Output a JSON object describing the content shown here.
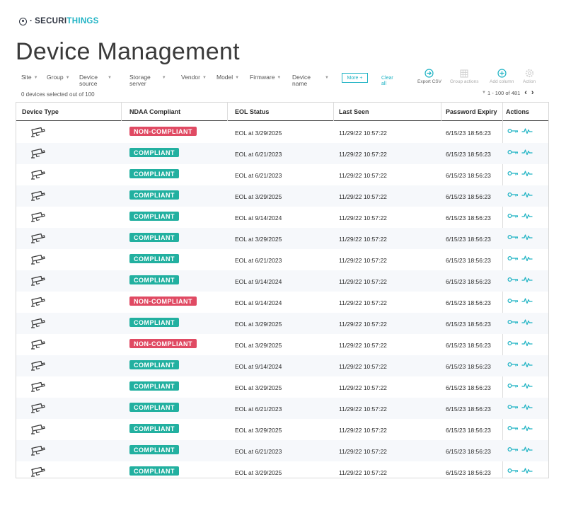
{
  "app": {
    "logo_part1": "SECURI",
    "logo_part2": "THINGS",
    "title": "Device Management"
  },
  "filters": {
    "site": "Site",
    "group": "Group",
    "device_source_1": "Device",
    "device_source_2": "source",
    "storage_server_1": "Storage",
    "storage_server_2": "server",
    "vendor": "Vendor",
    "model": "Model",
    "firmware": "Firmware",
    "device_name_1": "Device",
    "device_name_2": "name",
    "more": "More +",
    "clear_1": "Clear",
    "clear_2": "all"
  },
  "toolbar": {
    "export_csv": "Export CSV",
    "group_actions": "Group actions",
    "add_column": "Add column",
    "action": "Action"
  },
  "selection": "0 devices selected out of 100",
  "pagination": "1 - 100 of 481",
  "columns": {
    "device_type": "Device Type",
    "ndaa": "NDAA Compliant",
    "eol": "EOL Status",
    "last_seen": "Last Seen",
    "password_expiry": "Password Expiry",
    "actions": "Actions"
  },
  "rows": [
    {
      "ndaa": "NON-COMPLIANT",
      "status": "bad",
      "eol": "EOL at 3/29/2025",
      "last_seen": "11/29/22 10:57:22",
      "pwd": "6/15/23 18:56:23"
    },
    {
      "ndaa": "COMPLIANT",
      "status": "ok",
      "eol": "EOL at 6/21/2023",
      "last_seen": "11/29/22 10:57:22",
      "pwd": "6/15/23 18:56:23"
    },
    {
      "ndaa": "COMPLIANT",
      "status": "ok",
      "eol": "EOL at 6/21/2023",
      "last_seen": "11/29/22 10:57:22",
      "pwd": "6/15/23 18:56:23"
    },
    {
      "ndaa": "COMPLIANT",
      "status": "ok",
      "eol": "EOL at 3/29/2025",
      "last_seen": "11/29/22 10:57:22",
      "pwd": "6/15/23 18:56:23"
    },
    {
      "ndaa": "COMPLIANT",
      "status": "ok",
      "eol": "EOL at 9/14/2024",
      "last_seen": "11/29/22 10:57:22",
      "pwd": "6/15/23 18:56:23"
    },
    {
      "ndaa": "COMPLIANT",
      "status": "ok",
      "eol": "EOL at 3/29/2025",
      "last_seen": "11/29/22 10:57:22",
      "pwd": "6/15/23 18:56:23"
    },
    {
      "ndaa": "COMPLIANT",
      "status": "ok",
      "eol": "EOL at 6/21/2023",
      "last_seen": "11/29/22 10:57:22",
      "pwd": "6/15/23 18:56:23"
    },
    {
      "ndaa": "COMPLIANT",
      "status": "ok",
      "eol": "EOL at 9/14/2024",
      "last_seen": "11/29/22 10:57:22",
      "pwd": "6/15/23 18:56:23"
    },
    {
      "ndaa": "NON-COMPLIANT",
      "status": "bad",
      "eol": "EOL at 9/14/2024",
      "last_seen": "11/29/22 10:57:22",
      "pwd": "6/15/23 18:56:23"
    },
    {
      "ndaa": "COMPLIANT",
      "status": "ok",
      "eol": "EOL at 3/29/2025",
      "last_seen": "11/29/22 10:57:22",
      "pwd": "6/15/23 18:56:23"
    },
    {
      "ndaa": "NON-COMPLIANT",
      "status": "bad",
      "eol": "EOL at 3/29/2025",
      "last_seen": "11/29/22 10:57:22",
      "pwd": "6/15/23 18:56:23"
    },
    {
      "ndaa": "COMPLIANT",
      "status": "ok",
      "eol": "EOL at 9/14/2024",
      "last_seen": "11/29/22 10:57:22",
      "pwd": "6/15/23 18:56:23"
    },
    {
      "ndaa": "COMPLIANT",
      "status": "ok",
      "eol": "EOL at 3/29/2025",
      "last_seen": "11/29/22 10:57:22",
      "pwd": "6/15/23 18:56:23"
    },
    {
      "ndaa": "COMPLIANT",
      "status": "ok",
      "eol": "EOL at 6/21/2023",
      "last_seen": "11/29/22 10:57:22",
      "pwd": "6/15/23 18:56:23"
    },
    {
      "ndaa": "COMPLIANT",
      "status": "ok",
      "eol": "EOL at 3/29/2025",
      "last_seen": "11/29/22 10:57:22",
      "pwd": "6/15/23 18:56:23"
    },
    {
      "ndaa": "COMPLIANT",
      "status": "ok",
      "eol": "EOL at 6/21/2023",
      "last_seen": "11/29/22 10:57:22",
      "pwd": "6/15/23 18:56:23"
    },
    {
      "ndaa": "COMPLIANT",
      "status": "ok",
      "eol": "EOL at 3/29/2025",
      "last_seen": "11/29/22 10:57:22",
      "pwd": "6/15/23 18:56:23"
    }
  ],
  "icons": {
    "device": "camera-icon",
    "action1": "key-icon",
    "action2": "heartbeat-icon"
  },
  "colors": {
    "accent": "#1fb3c4",
    "compliant": "#22b0a0",
    "non_compliant": "#e04a63"
  }
}
